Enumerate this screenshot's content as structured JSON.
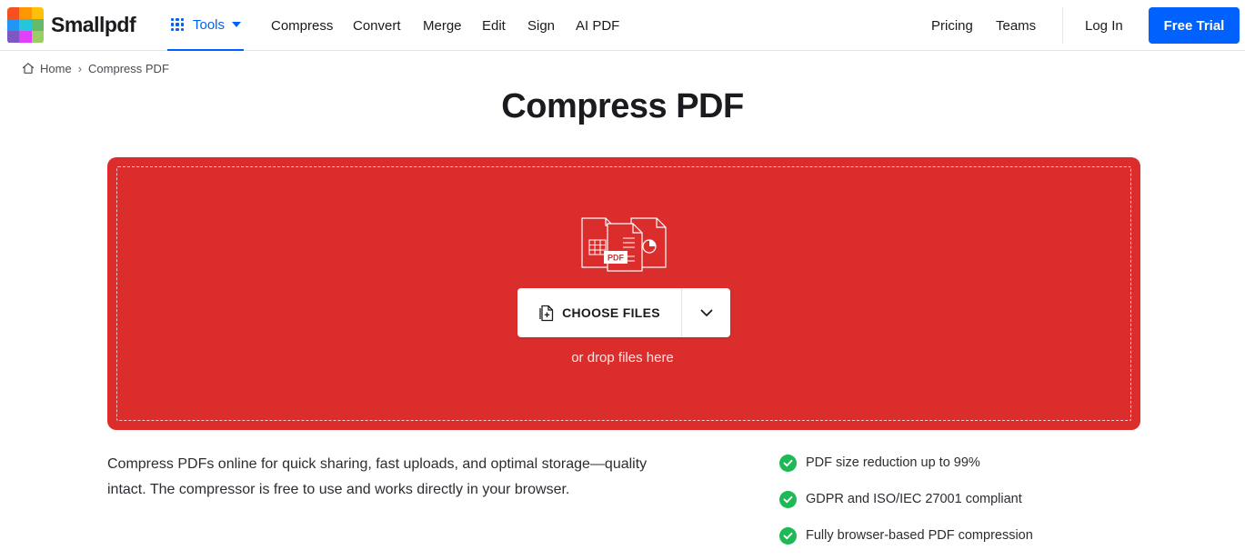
{
  "brand": {
    "name": "Smallpdf",
    "logo_colors": [
      "#f44336",
      "#ff9800",
      "#ffc107",
      "#2196f3",
      "#03a9f4",
      "#4caf50",
      "#9c27b0",
      "#e040fb",
      "#8bc34a"
    ]
  },
  "nav": {
    "tools_label": "Tools",
    "links": [
      "Compress",
      "Convert",
      "Merge",
      "Edit",
      "Sign",
      "AI PDF"
    ],
    "right_links": [
      "Pricing",
      "Teams"
    ],
    "login_label": "Log In",
    "trial_label": "Free Trial"
  },
  "breadcrumb": {
    "home": "Home",
    "separator": "›",
    "current": "Compress PDF"
  },
  "page": {
    "title": "Compress PDF"
  },
  "dropzone": {
    "illustration_label": "PDF",
    "choose_label": "CHOOSE FILES",
    "hint": "or drop files here"
  },
  "description": {
    "line1": "Compress PDFs online for quick sharing, fast uploads, and optimal storage—quality",
    "line2": "intact. The compressor is free to use and works directly in your browser."
  },
  "features": [
    "PDF size reduction up to 99%",
    "GDPR and ISO/IEC 27001 compliant",
    "Fully browser-based PDF compression"
  ],
  "colors": {
    "accent": "#0061fe",
    "dropzone": "#dc2d2d",
    "check": "#1db954"
  }
}
